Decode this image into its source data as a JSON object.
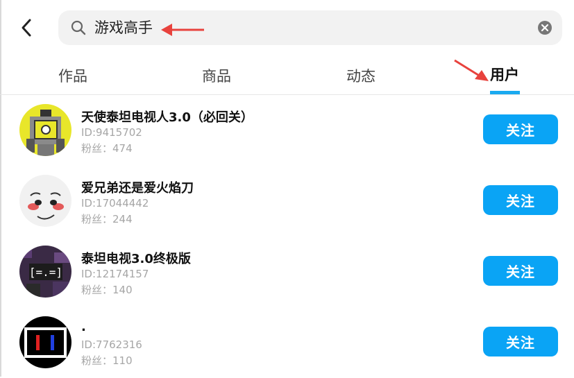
{
  "search": {
    "query": "游戏高手"
  },
  "tabs": [
    {
      "label": "作品"
    },
    {
      "label": "商品"
    },
    {
      "label": "动态"
    },
    {
      "label": "用户"
    }
  ],
  "active_tab": "用户",
  "users": [
    {
      "name": "天使泰坦电视人3.0（必回关）",
      "id": "ID:9415702",
      "fans": "粉丝：474",
      "follow_label": "关注"
    },
    {
      "name": "爱兄弟还是爱火焰刀",
      "id": "ID:17044442",
      "fans": "粉丝：244",
      "follow_label": "关注"
    },
    {
      "name": "泰坦电视3.0终极版",
      "id": "ID:12174157",
      "fans": "粉丝：140",
      "follow_label": "关注"
    },
    {
      "name": ".",
      "id": "ID:7762316",
      "fans": "粉丝：110",
      "follow_label": "关注"
    }
  ],
  "colors": {
    "accent": "#0aa4f5",
    "annotation_arrow": "#e8423d"
  },
  "icons": {
    "back": "back-arrow-icon",
    "search": "search-icon",
    "clear": "clear-icon"
  }
}
